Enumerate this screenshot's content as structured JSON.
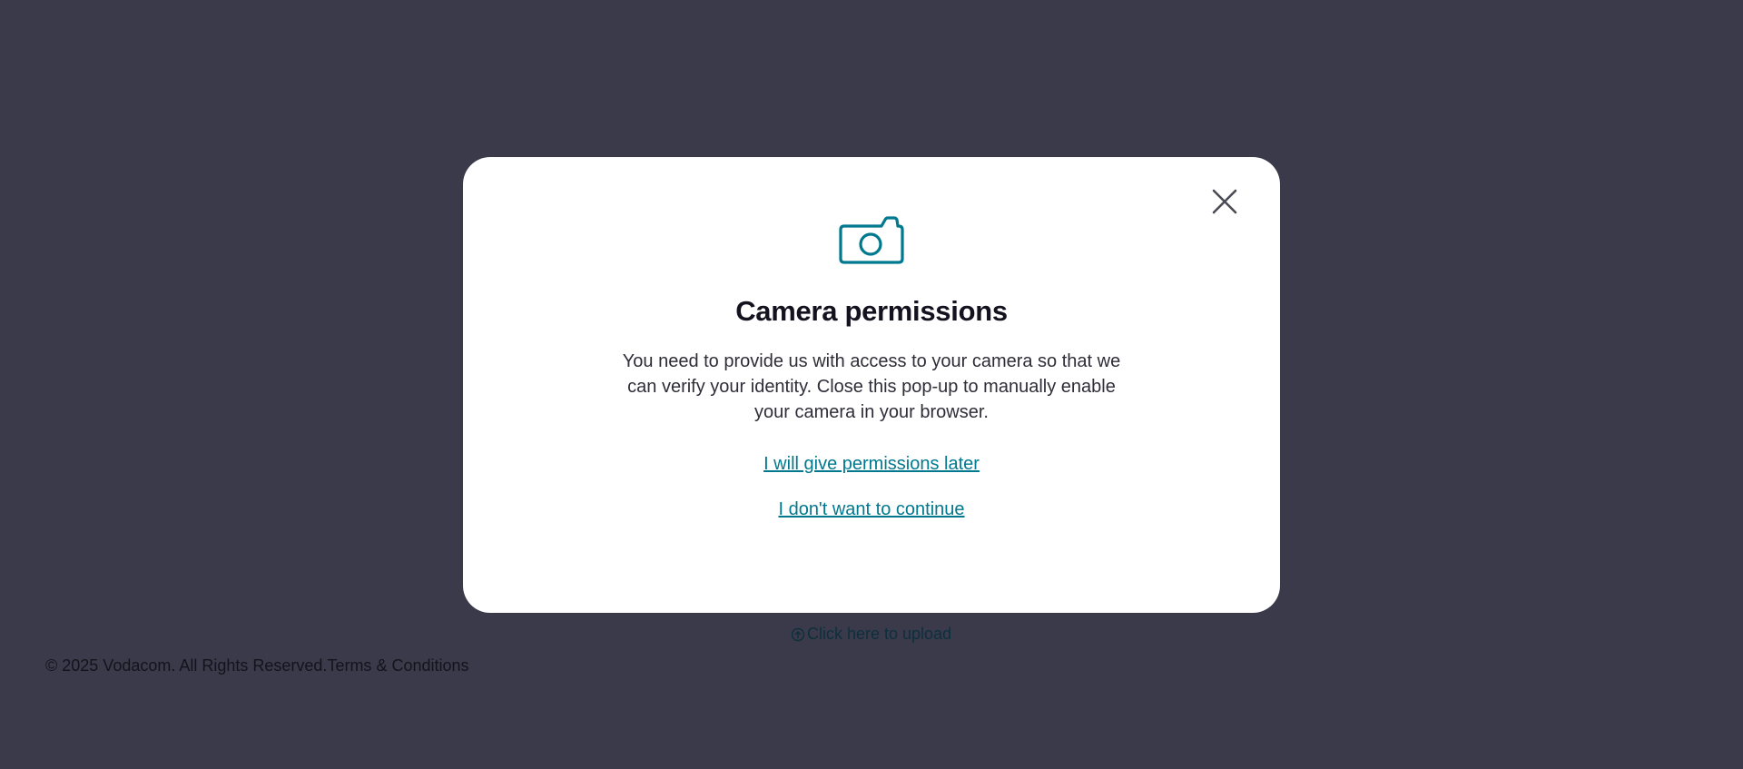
{
  "page": {
    "upload_link": "Click here to upload",
    "upload_icon": "upload-arrow-icon",
    "footer": {
      "copyright": "© 2025 Vodacom. All Rights Reserved.",
      "terms_link": "Terms & Conditions"
    }
  },
  "modal": {
    "icon": "camera-icon",
    "close_icon": "close-icon",
    "title": "Camera permissions",
    "body": "You need to provide us with access to your camera so that we can verify your identity. Close this pop-up to manually enable your camera in your browser.",
    "link_later": "I will give permissions later",
    "link_decline": "I don't want to continue"
  },
  "colors": {
    "overlay_background": "#3b3a4a",
    "accent": "#00798f",
    "modal_background": "#ffffff"
  }
}
